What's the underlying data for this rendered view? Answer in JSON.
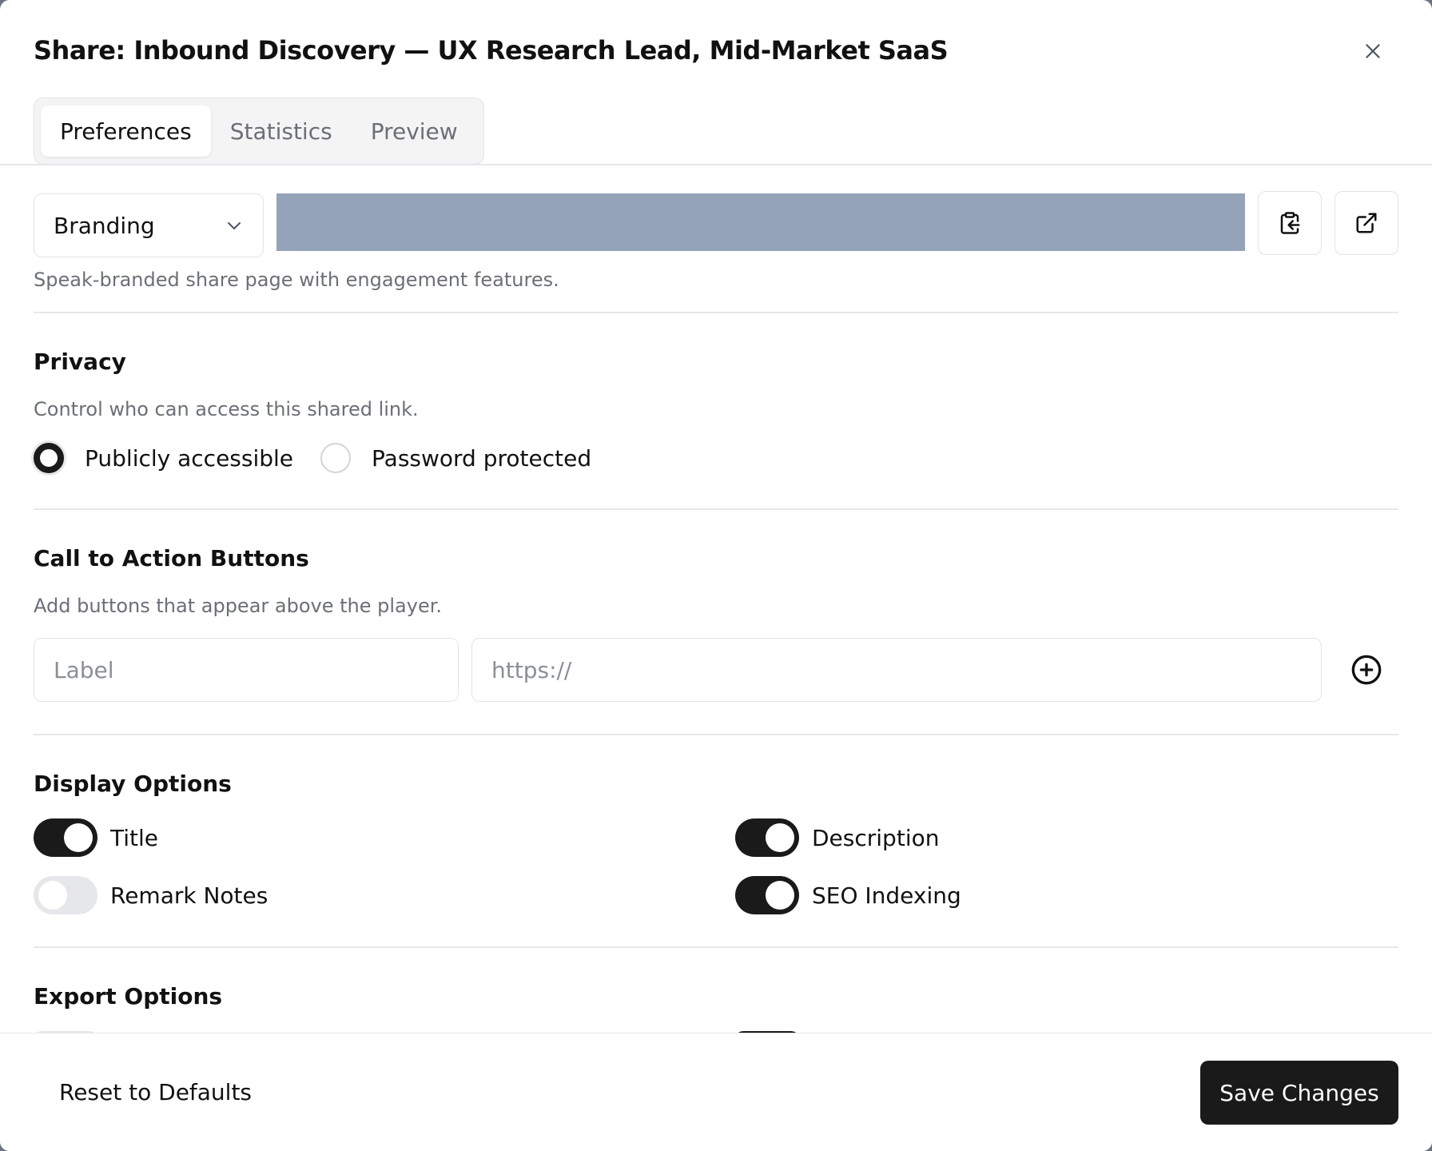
{
  "dialog": {
    "title": "Share: Inbound Discovery — UX Research Lead, Mid-Market SaaS",
    "close_icon": "close-icon"
  },
  "tabs": [
    {
      "label": "Preferences",
      "active": true
    },
    {
      "label": "Statistics",
      "active": false
    },
    {
      "label": "Preview",
      "active": false
    }
  ],
  "share": {
    "mode_selected": "Branding",
    "mode_description": "Speak-branded share page with engagement features.",
    "copy_icon": "clipboard-copy-icon",
    "open_icon": "external-link-icon",
    "url_bar_color": "#94a3b8"
  },
  "privacy": {
    "title": "Privacy",
    "description": "Control who can access this shared link.",
    "options": [
      {
        "label": "Publicly accessible",
        "checked": true
      },
      {
        "label": "Password protected",
        "checked": false
      }
    ]
  },
  "cta": {
    "title": "Call to Action Buttons",
    "description": "Add buttons that appear above the player.",
    "label_placeholder": "Label",
    "url_placeholder": "https://",
    "add_icon": "plus-circle-icon"
  },
  "display": {
    "title": "Display Options",
    "toggles": [
      {
        "label": "Title",
        "on": true
      },
      {
        "label": "Description",
        "on": true
      },
      {
        "label": "Remark Notes",
        "on": false
      },
      {
        "label": "SEO Indexing",
        "on": true
      }
    ]
  },
  "export": {
    "title": "Export Options"
  },
  "footer": {
    "reset_label": "Reset to Defaults",
    "save_label": "Save Changes"
  },
  "colors": {
    "accent": "#1a1a1a",
    "muted_text": "#6b6f76",
    "border": "#e2e4e8"
  }
}
